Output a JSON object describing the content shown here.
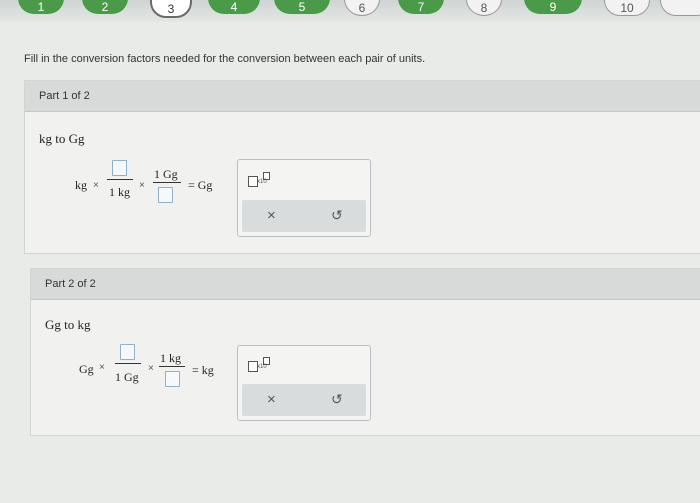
{
  "steps": [
    "1",
    "2",
    "3",
    "4",
    "5",
    "6",
    "7",
    "8",
    "9",
    "10"
  ],
  "instruction": "Fill in the conversion factors needed for the conversion between each pair of units.",
  "part1": {
    "header": "Part 1 of 2",
    "prompt": "kg to Gg",
    "start_unit": "kg",
    "den1_unit": "1 kg",
    "num2_unit": "1 Gg",
    "result": "= Gg",
    "sci_label": "x10",
    "icons": {
      "clear": "x-icon",
      "undo": "undo-icon"
    }
  },
  "part2": {
    "header": "Part 2 of 2",
    "prompt": "Gg to kg",
    "start_unit": "Gg",
    "den1_unit": "1 Gg",
    "num2_unit": "1 kg",
    "result": "= kg",
    "sci_label": "x10",
    "icons": {
      "clear": "x-icon",
      "undo": "undo-icon"
    }
  },
  "times": "×",
  "clear_label": "×",
  "undo_label": "↺"
}
